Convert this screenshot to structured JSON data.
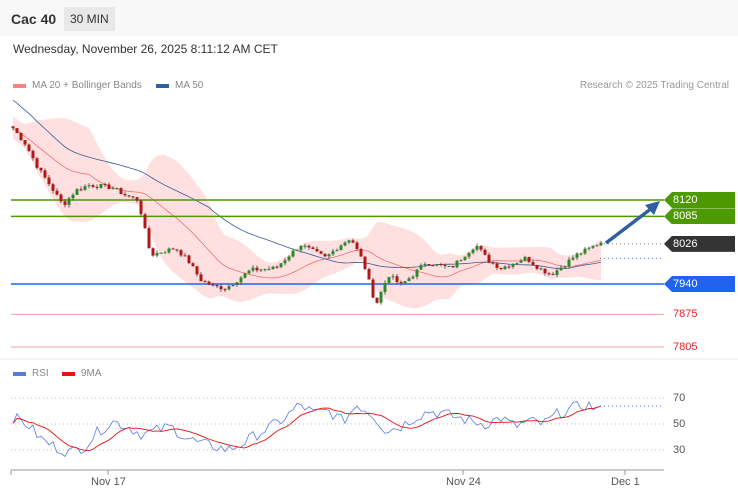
{
  "header": {
    "title": "Cac 40",
    "timeframe": "30 MIN",
    "date": "Wednesday, November 26, 2025 8:11:12 AM CET"
  },
  "legend": {
    "ma20": "MA 20 + Bollinger Bands",
    "ma50": "MA 50",
    "rsi": "RSI",
    "ma9": "9MA"
  },
  "credit": "Research © 2025 Trading Central",
  "levels": [
    {
      "value": 8120,
      "label": "8120",
      "color": "#4c9a00",
      "style": "tag"
    },
    {
      "value": 8085,
      "label": "8085",
      "color": "#4c9a00",
      "style": "tag"
    },
    {
      "value": 8026,
      "label": "8026",
      "color": "#333333",
      "style": "tag-dotted"
    },
    {
      "value": 7940,
      "label": "7940",
      "color": "#1e64f0",
      "style": "tag"
    },
    {
      "value": 7875,
      "label": "7875",
      "color": "#e8202a",
      "style": "plain"
    },
    {
      "value": 7805,
      "label": "7805",
      "color": "#e8202a",
      "style": "plain"
    }
  ],
  "rsi_levels": [
    "70",
    "50",
    "30"
  ],
  "x_labels": [
    "Nov 17",
    "Nov 24",
    "Dec 1"
  ],
  "chart_data": {
    "type": "candlestick",
    "price_path_keypoints": [
      8274,
      8240,
      8189,
      8150,
      8109,
      8140,
      8152,
      8150,
      8146,
      8130,
      8120,
      8002,
      8010,
      8017,
      7990,
      7949,
      7935,
      7931,
      7950,
      7970,
      7972,
      7974,
      8000,
      8024,
      8010,
      7996,
      8020,
      8039,
      7987,
      7895,
      7960,
      7938,
      7960,
      7987,
      7980,
      7974,
      8000,
      8024,
      7990,
      7974,
      7985,
      7996,
      7975,
      7960,
      7980,
      8002,
      8015,
      8030
    ],
    "rsi_keypoints": [
      55,
      50,
      38,
      32,
      28,
      33,
      45,
      52,
      48,
      42,
      45,
      48,
      40,
      35,
      33,
      30,
      35,
      42,
      48,
      55,
      65,
      58,
      60,
      52,
      65,
      58,
      45,
      48,
      55,
      60,
      58,
      55,
      52,
      50,
      55,
      48,
      52,
      50,
      58,
      62,
      65,
      60
    ],
    "rsi_ylim": [
      20,
      80
    ],
    "series": [
      "Price",
      "MA 20",
      "Bollinger Bands",
      "MA 50",
      "RSI",
      "9MA"
    ]
  }
}
